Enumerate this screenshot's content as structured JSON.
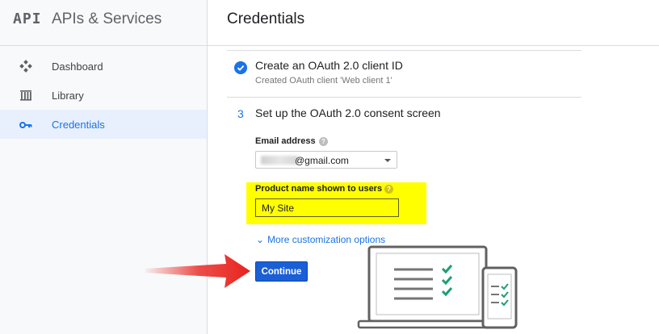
{
  "app": {
    "logo": "API",
    "title": "APIs & Services"
  },
  "sidebar": {
    "items": [
      {
        "label": "Dashboard",
        "icon": "dashboard-icon"
      },
      {
        "label": "Library",
        "icon": "library-icon"
      },
      {
        "label": "Credentials",
        "icon": "key-icon",
        "active": true
      }
    ]
  },
  "header": {
    "title": "Credentials"
  },
  "steps": {
    "step1": {
      "title": "Create an OAuth 2.0 client ID",
      "subtitle": "Created OAuth client 'Web client 1'",
      "status_icon": "check-circle-icon"
    },
    "step3": {
      "number": "3",
      "title": "Set up the OAuth 2.0 consent screen"
    }
  },
  "form": {
    "email_label": "Email address",
    "email_value_visible": "gmail.com",
    "email_display": "@gmail.com",
    "help_icon": "help-icon",
    "product_label": "Product name shown to users",
    "product_value": "My Site",
    "more_options": "More customization options",
    "continue_label": "Continue"
  },
  "colors": {
    "accent": "#1a73e8",
    "highlight": "#ffff00",
    "arrow": "#e8231e",
    "button": "#1a5fd6"
  }
}
